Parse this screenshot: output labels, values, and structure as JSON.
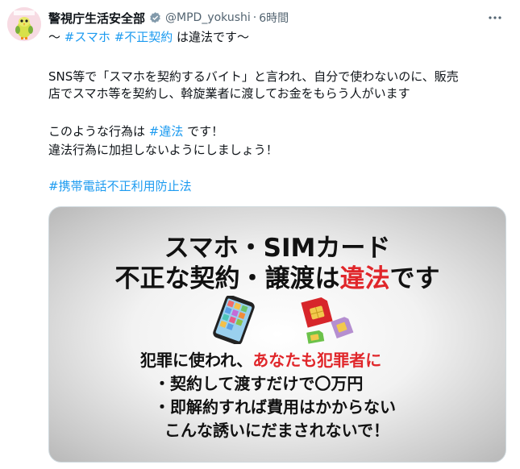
{
  "tweet": {
    "author": {
      "display_name": "警視庁生活安全部",
      "verified_icon": "verified-badge-icon",
      "handle": "@MPD_yokushi",
      "separator": "·",
      "time": "6時間",
      "avatar_icon": "mascot-avatar"
    },
    "more_icon": "more-dots-icon",
    "body": {
      "line1": {
        "prefix": "〜 ",
        "tag1": "#スマホ",
        "space": " ",
        "tag2": "#不正契約",
        "suffix": " は違法です〜"
      },
      "line2": "SNS等で「スマホを契約するバイト」と言われ、自分で使わないのに、販売",
      "line3": "店でスマホ等を契約し、斡旋業者に渡してお金をもらう人がいます",
      "line4": {
        "prefix": "このような行為は ",
        "tag": "#違法",
        "suffix": " です！"
      },
      "line5": "違法行為に加担しないようにしましょう！",
      "line6_tag": "#携帯電話不正利用防止法"
    },
    "media": {
      "title_line1": "スマホ・SIMカード",
      "title_line2_pre": "不正な契約・譲渡は",
      "title_line2_red": "違法",
      "title_line2_post": "です",
      "warn_pre": "犯罪に使われ、",
      "warn_red": "あなたも犯罪者に",
      "bullet1": "・契約して渡すだけで〇万円",
      "bullet2": "・即解約すれば費用はかからない",
      "closing": "こんな誘いにだまされないで！",
      "icons": [
        "smartphone-icon",
        "sim-card-icon"
      ]
    },
    "colors": {
      "accent": "#1d9bf0",
      "secondary_text": "#536471",
      "warning_red": "#e0262a"
    }
  }
}
